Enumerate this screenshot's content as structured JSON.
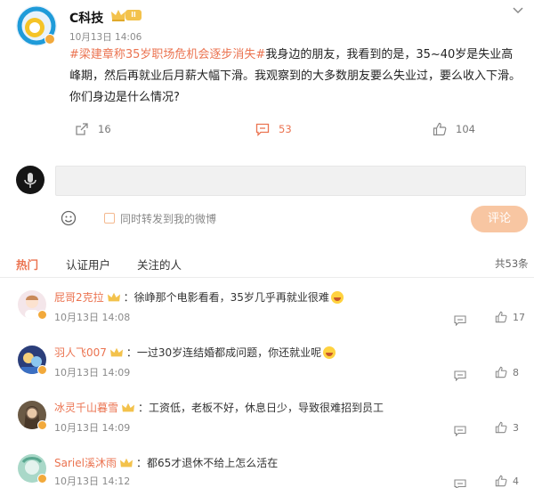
{
  "post": {
    "author": "C科技",
    "vip_label": "ll",
    "time": "10月13日 14:06",
    "hashtag": "#梁建章称35岁职场危机会逐步消失#",
    "text": "我身边的朋友，我看到的是，35~40岁是失业高峰期，然后再就业后月薪大幅下滑。我观察到的大多数朋友要么失业过，要么收入下滑。你们身边是什么情况?",
    "actions": {
      "forward": "16",
      "comment": "53",
      "like": "104"
    }
  },
  "composer": {
    "forward_label": "同时转发到我的微博",
    "submit_label": "评论"
  },
  "tabs": {
    "hot": "热门",
    "verified": "认证用户",
    "following": "关注的人",
    "total": "共53条"
  },
  "comments": [
    {
      "name": "屁哥2克拉",
      "text": "：徐峥那个电影看看，35岁几乎再就业很难",
      "emoji": "laugh-emoji",
      "time": "10月13日 14:08",
      "likes": "17"
    },
    {
      "name": "羽人飞007",
      "text": "：一过30岁连结婚都成问题，你还就业呢",
      "emoji": "laugh-emoji",
      "time": "10月13日 14:09",
      "likes": "8"
    },
    {
      "name": "冰灵千山暮雪",
      "text": "：工资低，老板不好，休息日少，导致很难招到员工",
      "time": "10月13日 14:09",
      "likes": "3"
    },
    {
      "name": "Sariel溪沐雨",
      "text": "：都65才退休不给上怎么活在",
      "time": "10月13日 14:12",
      "likes": "4"
    }
  ],
  "colors": {
    "accent": "#eb7350",
    "vip_gold": "#f3c24c",
    "submit_disabled": "#f8c6a2"
  }
}
